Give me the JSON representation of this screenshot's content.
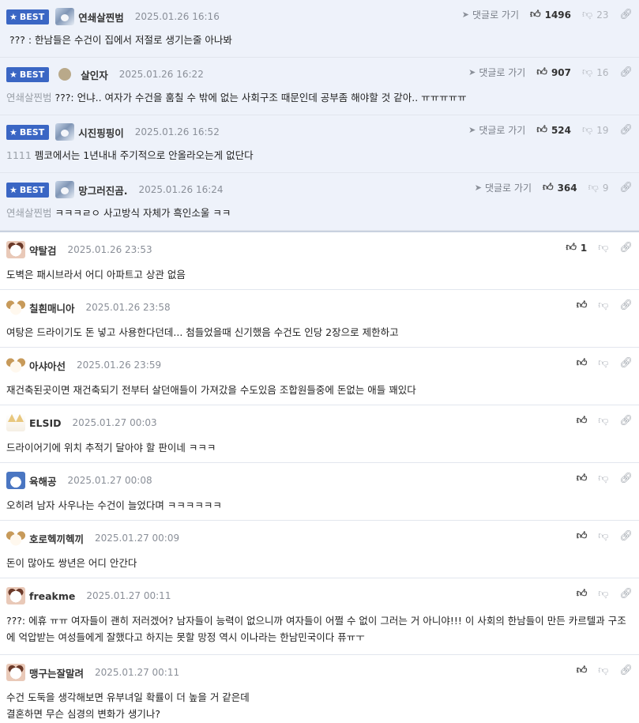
{
  "best_label": "BEST",
  "reply_label": "댓글로 가기",
  "comments": [
    {
      "best": true,
      "avatar": "wolf-avatar",
      "nick": "연쇄살찐범",
      "date": "2025.01.26 16:16",
      "ref": "",
      "text": "??? : 한남들은 수건이 집에서 저절로 생기는줄 아나봐",
      "up": "1496",
      "down": "23"
    },
    {
      "best": true,
      "avatar": "round-avatar",
      "nick": "살인자",
      "date": "2025.01.26 16:22",
      "ref": "연쇄살찐범",
      "text": "???: 언냐.. 여자가 수건을 훔칠 수 밖에 없는 사회구조 때문인데 공부좀 해야할 것 같아.. ㅠㅠㅠㅠㅠ",
      "up": "907",
      "down": "16"
    },
    {
      "best": true,
      "avatar": "wolf-avatar",
      "nick": "시진핑핑이",
      "date": "2025.01.26 16:52",
      "ref": "1111",
      "text": "펨코에서는 1년내내 주기적으로 안올라오는게 없단다",
      "up": "524",
      "down": "19"
    },
    {
      "best": true,
      "avatar": "wolf-avatar",
      "nick": "망그러진곰.",
      "date": "2025.01.26 16:24",
      "ref": "연쇄살찐범",
      "text": "ㅋㅋㅋㄹㅇ 사고방식 자체가 흑인소울 ㅋㅋ",
      "up": "364",
      "down": "9"
    },
    {
      "best": false,
      "avatar": "bear-avatar",
      "nick": "약탈검",
      "date": "2025.01.26 23:53",
      "ref": "",
      "text": "도벽은 패시브라서 어디 아파트고 상관 없음",
      "up": "1",
      "down": ""
    },
    {
      "best": false,
      "avatar": "puppy-avatar",
      "nick": "칠흰매니아",
      "date": "2025.01.26 23:58",
      "ref": "",
      "text": "여탕은 드라이기도 돈 넣고 사용한다던데... 첨들었을때 신기했음 수건도 인당 2장으로 제한하고",
      "up": "",
      "down": ""
    },
    {
      "best": false,
      "avatar": "puppy-avatar",
      "nick": "아샤아선",
      "date": "2025.01.26 23:59",
      "ref": "",
      "text": "재건축된곳이면 재건축되기 전부터 살던애들이 가져갔을 수도있음 조합원들중에 돈없는 애들 꽤있다",
      "up": "",
      "down": ""
    },
    {
      "best": false,
      "avatar": "fox-avatar",
      "nick": "ELSID",
      "date": "2025.01.27 00:03",
      "ref": "",
      "text": "드라이어기에 위치 추적기 달아야 할 판이네 ㅋㅋㅋ",
      "up": "",
      "down": ""
    },
    {
      "best": false,
      "avatar": "blue-avatar",
      "nick": "육해공",
      "date": "2025.01.27 00:08",
      "ref": "",
      "text": "오히려 남자 사우나는 수건이 늘었다며 ㅋㅋㅋㅋㅋㅋ",
      "up": "",
      "down": ""
    },
    {
      "best": false,
      "avatar": "puppy-avatar",
      "nick": "호로헥끼헥끼",
      "date": "2025.01.27 00:09",
      "ref": "",
      "text": "돈이 많아도 쌍년은 어디 안간다",
      "up": "",
      "down": ""
    },
    {
      "best": false,
      "avatar": "bear-avatar",
      "nick": "freakme",
      "date": "2025.01.27 00:11",
      "ref": "",
      "text": "???: 에휴 ㅠㅠ 여자들이 괜히 저러겠어? 남자들이 능력이 없으니까 여자들이 어쩔 수 없이 그러는 거 아니야!!! 이 사회의 한남들이 만든 카르텔과 구조에 억압받는 여성들에게 잘했다고 하지는 못할 망정 역시 이나라는 한남민국이다 퓨ㅠㅜ",
      "up": "",
      "down": ""
    },
    {
      "best": false,
      "avatar": "bear-avatar",
      "nick": "맹구는잘말려",
      "date": "2025.01.27 00:11",
      "ref": "",
      "text": "수건 도둑을 생각해보면 유부녀일 확률이 더 높을 거 같은데\n결혼하면 무슨 심경의 변화가 생기나?",
      "up": "",
      "down": ""
    }
  ]
}
